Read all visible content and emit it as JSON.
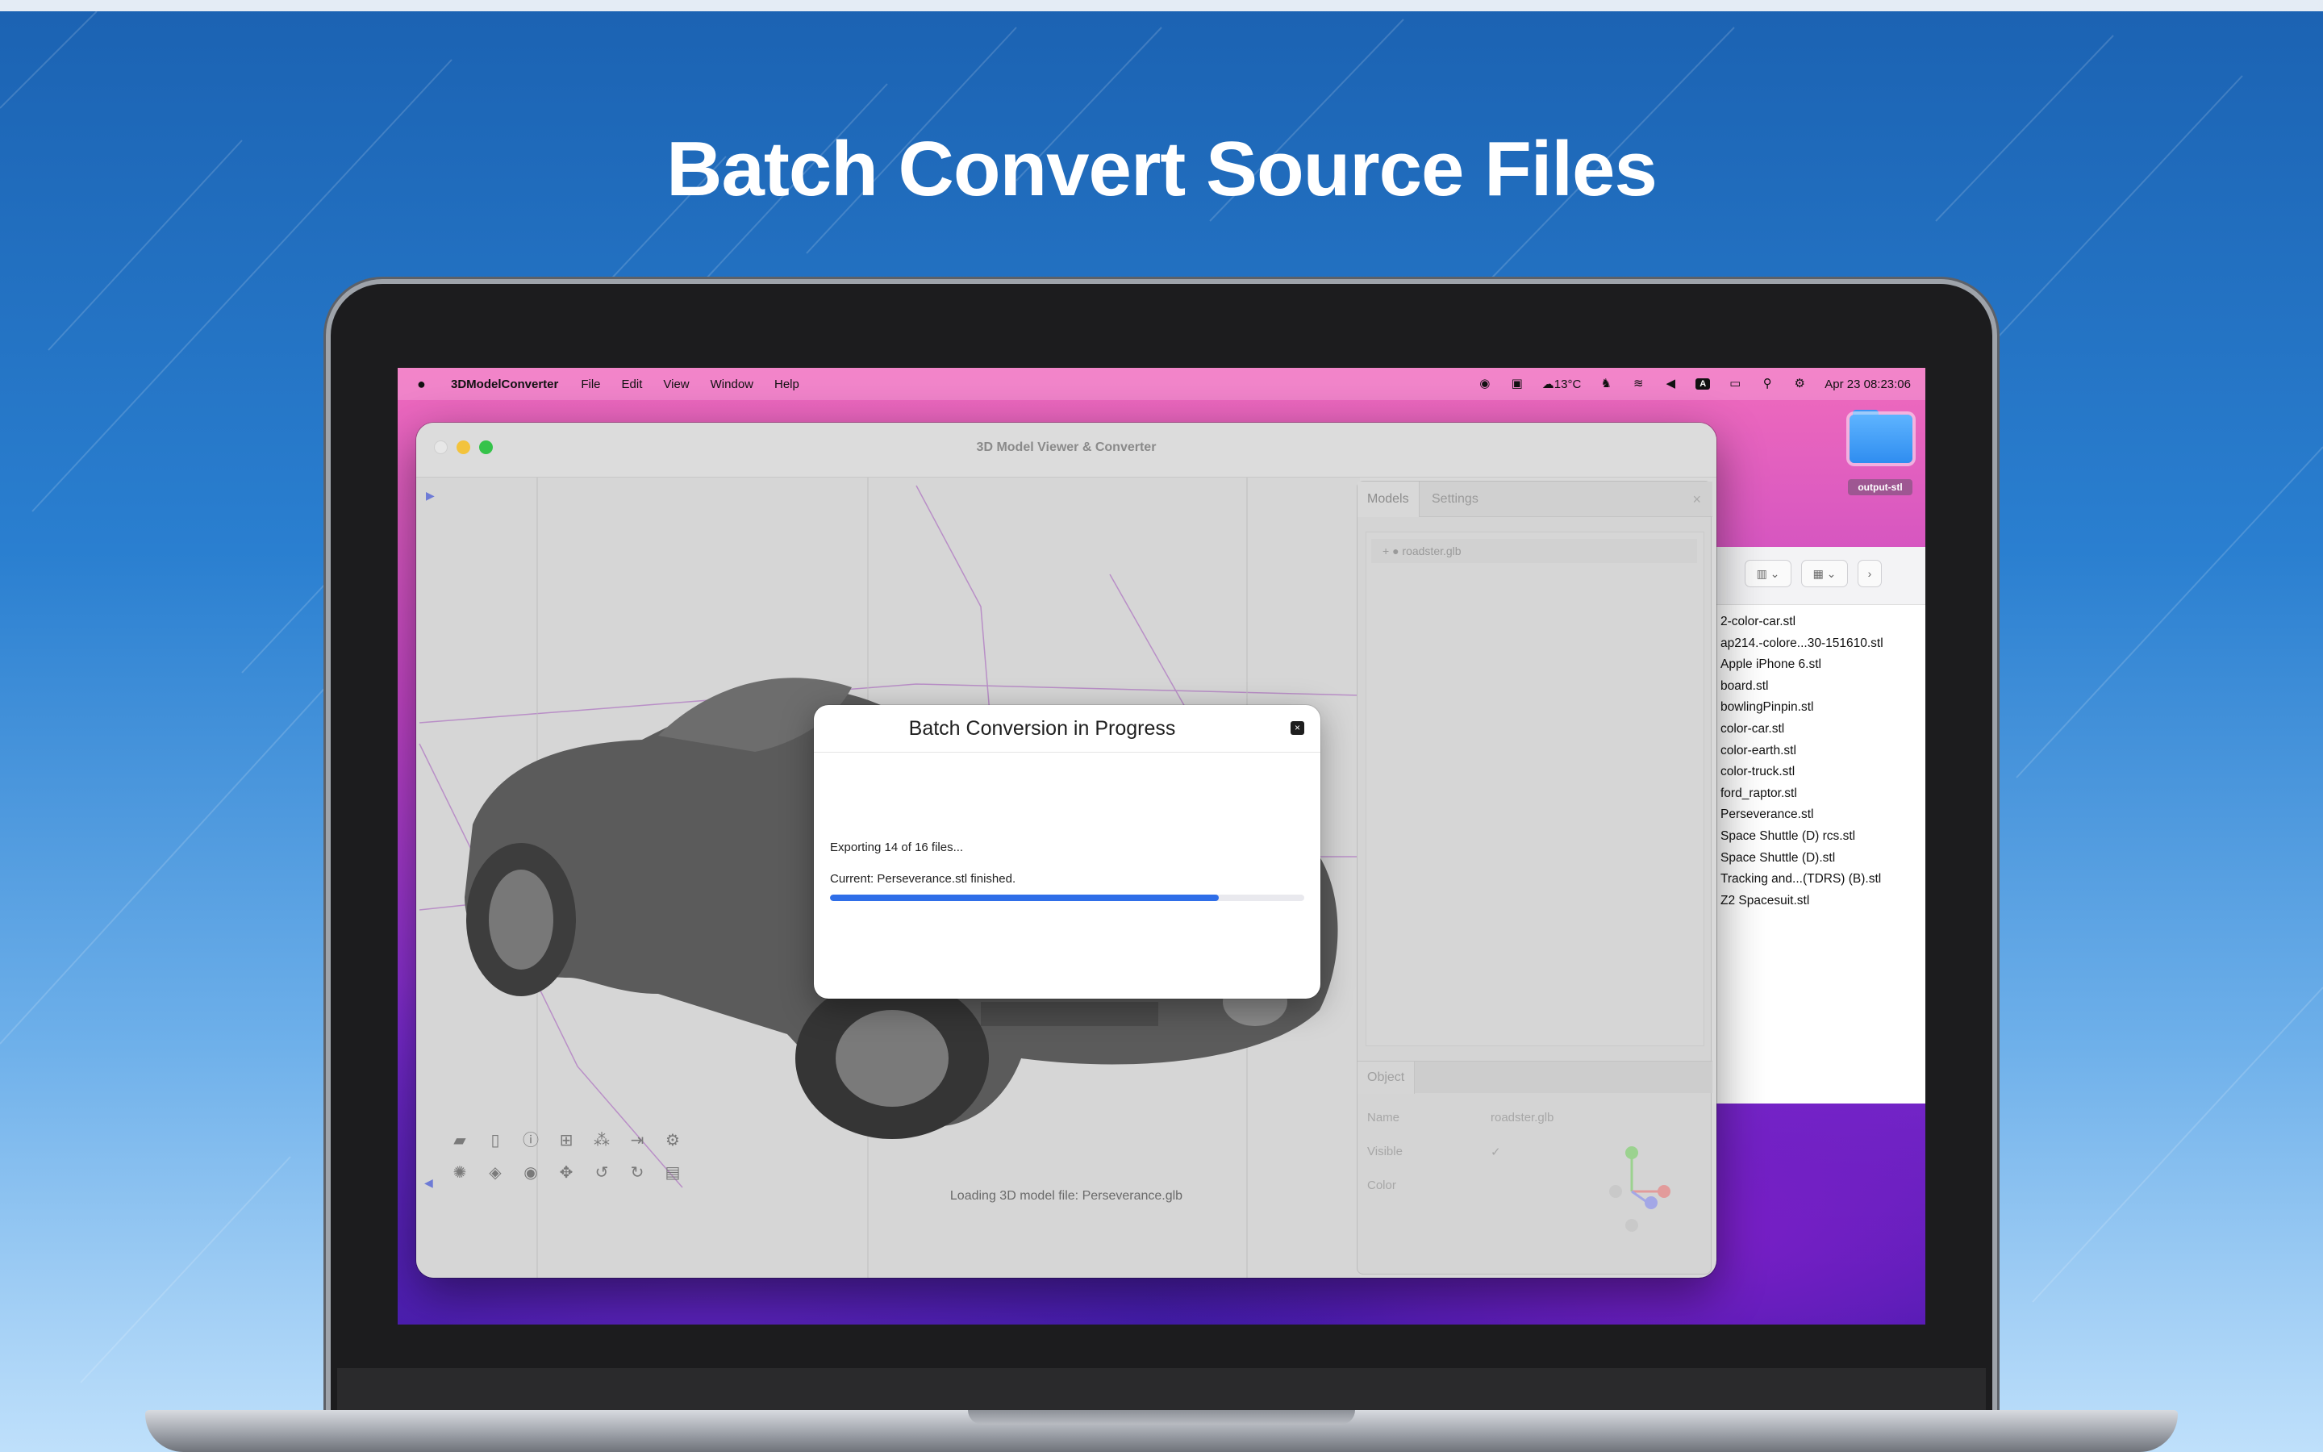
{
  "headline": "Batch Convert Source Files",
  "menubar": {
    "app_name": "3DModelConverter",
    "items": [
      "File",
      "Edit",
      "View",
      "Window",
      "Help"
    ],
    "weather": "13°C",
    "input_badge": "A",
    "datetime": "Apr 23  08:23:06"
  },
  "desktop": {
    "folder_label": "output-stl"
  },
  "finder": {
    "files": [
      {
        "name": "2-color-car.stl",
        "icon": "doc"
      },
      {
        "name": "ap214.-colore...30-151610.stl",
        "icon": "doc"
      },
      {
        "name": "Apple iPhone 6.stl",
        "icon": "doc"
      },
      {
        "name": "board.stl",
        "icon": "grey"
      },
      {
        "name": "bowlingPinpin.stl",
        "icon": "doc"
      },
      {
        "name": "color-car.stl",
        "icon": "doc"
      },
      {
        "name": "color-earth.stl",
        "icon": "doc"
      },
      {
        "name": "color-truck.stl",
        "icon": "doc"
      },
      {
        "name": "ford_raptor.stl",
        "icon": "blue"
      },
      {
        "name": "Perseverance.stl",
        "icon": "blue"
      },
      {
        "name": "Space Shuttle (D) rcs.stl",
        "icon": "doc"
      },
      {
        "name": "Space Shuttle (D).stl",
        "icon": "doc"
      },
      {
        "name": "Tracking and...(TDRS) (B).stl",
        "icon": "doc"
      },
      {
        "name": "Z2 Spacesuit.stl",
        "icon": "doc"
      }
    ]
  },
  "window": {
    "title": "3D Model Viewer & Converter",
    "status": "Loading 3D model file: Perseverance.glb"
  },
  "sidepanel": {
    "tabs": [
      "Models",
      "Settings"
    ],
    "model_row": "+ ●  roadster.glb",
    "object_tab": "Object",
    "props": {
      "name_label": "Name",
      "name_value": "roadster.glb",
      "visible_label": "Visible",
      "visible_value": "✓",
      "color_label": "Color"
    }
  },
  "dialog": {
    "title": "Batch Conversion in Progress",
    "exporting": "Exporting 14 of 16 files...",
    "current": "Current: Perseverance.stl finished.",
    "progress_percent": 82,
    "progress_color": "#2f6ee8"
  },
  "toolbar_icons": [
    "open-folder-icon",
    "new-file-icon",
    "info-icon",
    "grid-icon",
    "shapes-icon",
    "export-icon",
    "settings-icon",
    "texture-icon",
    "cube-icon",
    "target-icon",
    "move-icon",
    "undo-icon",
    "redo-icon",
    "trash-icon"
  ]
}
